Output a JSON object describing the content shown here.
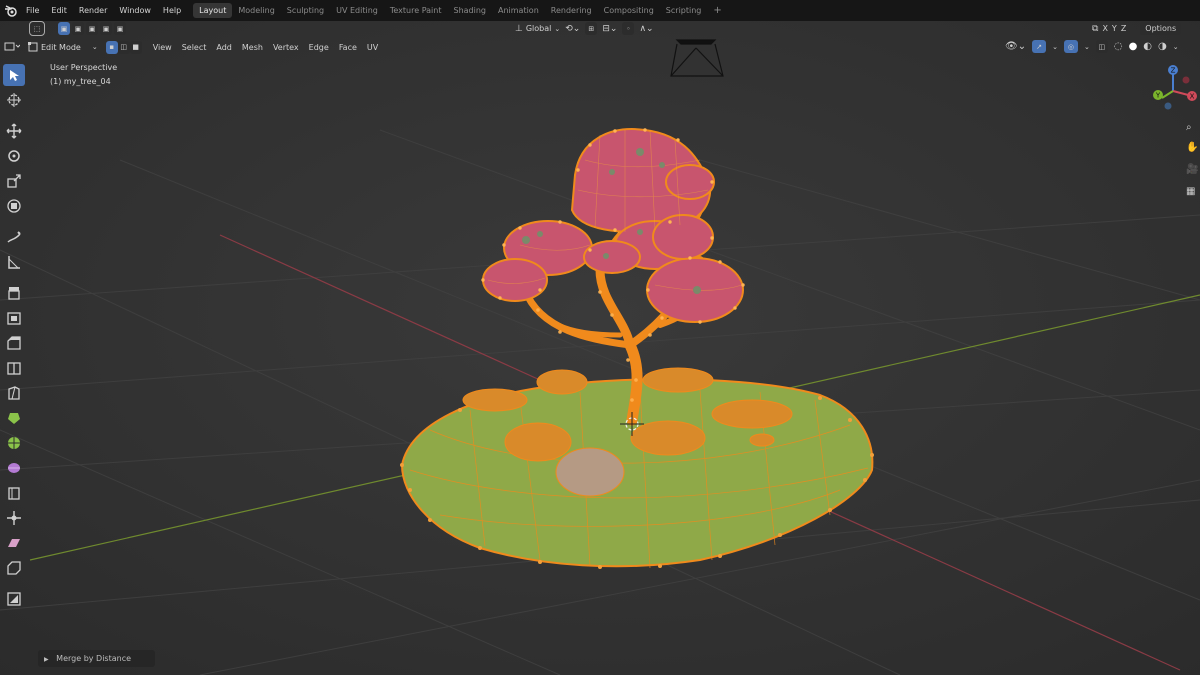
{
  "topbar": {
    "menus": [
      "File",
      "Edit",
      "Render",
      "Window",
      "Help"
    ],
    "workspaces": [
      "Layout",
      "Modeling",
      "Sculpting",
      "UV Editing",
      "Texture Paint",
      "Shading",
      "Animation",
      "Rendering",
      "Compositing",
      "Scripting"
    ],
    "active_workspace": "Layout",
    "add_tab": "+",
    "axes": [
      "X",
      "Y",
      "Z"
    ],
    "options": "Options"
  },
  "header": {
    "mode": "Edit Mode",
    "menus": [
      "View",
      "Select",
      "Add",
      "Mesh",
      "Vertex",
      "Edge",
      "Face",
      "UV"
    ],
    "orientation": "Global"
  },
  "viewport": {
    "view_name": "User Perspective",
    "object_name": "(1) my_tree_04"
  },
  "gizmo": {
    "x": "X",
    "y": "Y",
    "z": "Z"
  },
  "operator_panel": {
    "label": "Merge by Distance"
  },
  "colors": {
    "select_orange": "#f08a1c",
    "foliage_pink": "#c8556e",
    "ground_green": "#8fa948",
    "active_tool": "#4772b3"
  }
}
